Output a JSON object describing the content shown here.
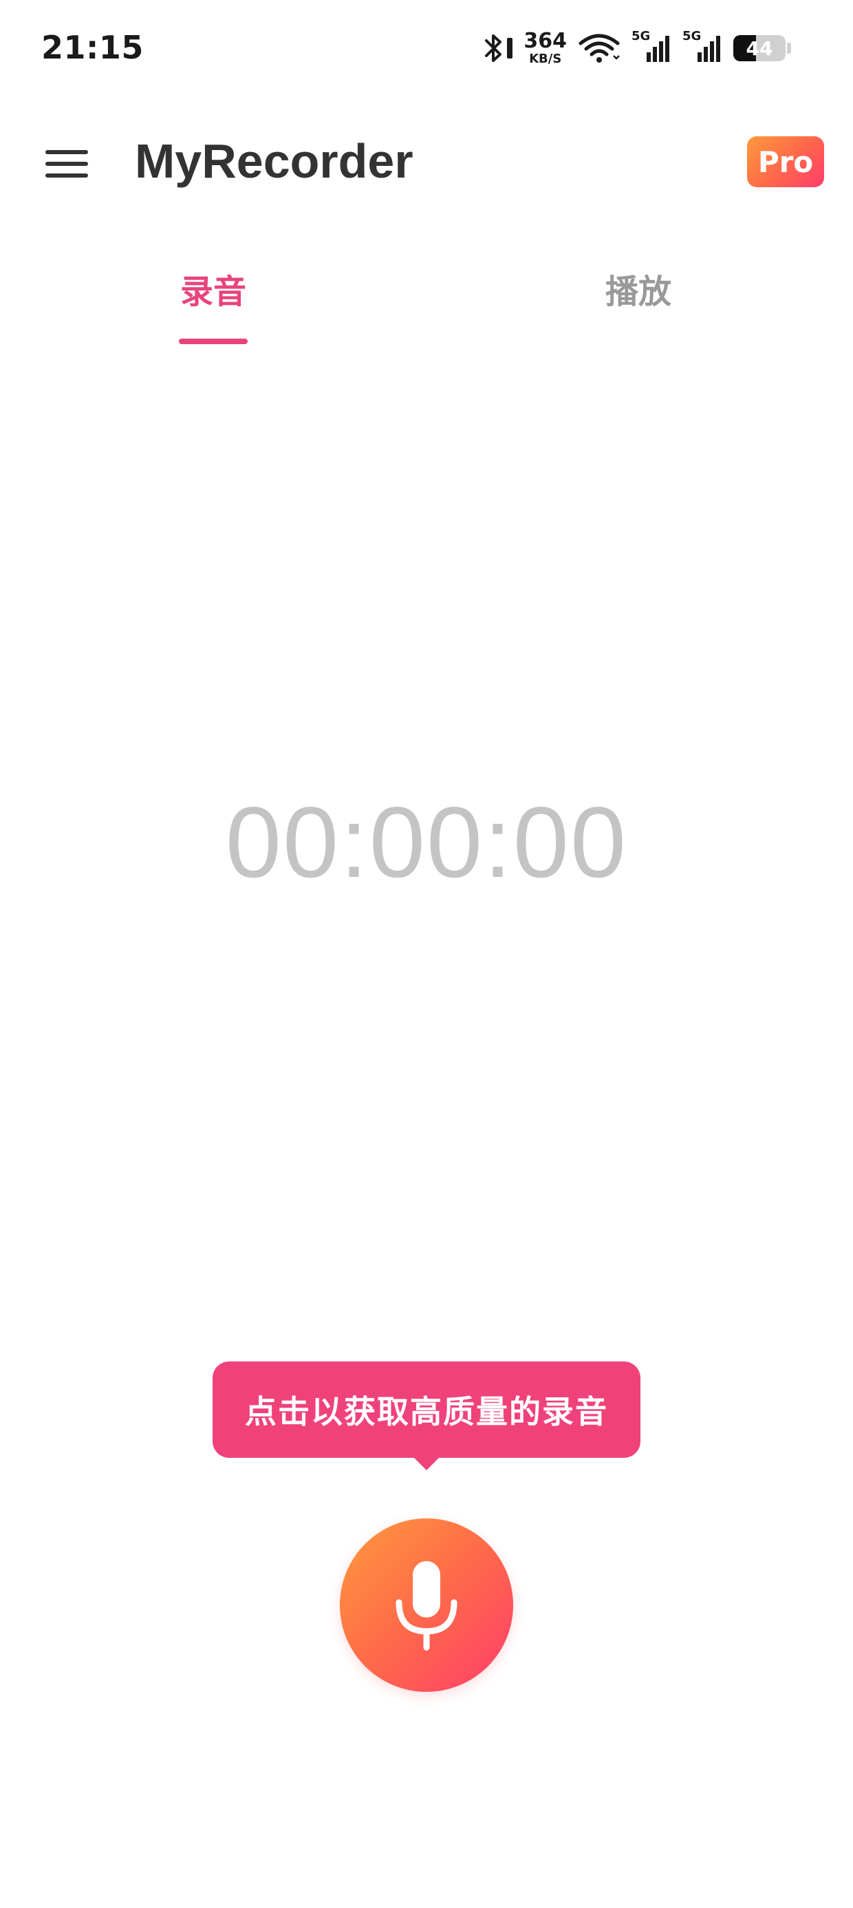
{
  "status_bar": {
    "time": "21:15",
    "net_speed_value": "364",
    "net_speed_unit": "KB/S",
    "signal_1_label": "5G",
    "signal_2_label": "5G",
    "battery_level": "44",
    "battery_fraction": 0.44
  },
  "app_bar": {
    "title": "MyRecorder",
    "pro_label": "Pro"
  },
  "tabs": [
    {
      "label": "录音",
      "active": true
    },
    {
      "label": "播放",
      "active": false
    }
  ],
  "recorder": {
    "timer": "00:00:00",
    "tooltip": "点击以获取高质量的录音"
  },
  "colors": {
    "accent": "#e8447a",
    "tooltip_bg": "#f0427a",
    "gradient_start": "#ff9a3c",
    "gradient_end": "#ff3d6b",
    "timer_text": "#c4c4c4",
    "inactive_tab": "#999999"
  },
  "icons": {
    "menu": "hamburger-menu-icon",
    "record": "microphone-icon",
    "bluetooth": "bluetooth-icon",
    "wifi": "wifi-icon",
    "battery": "battery-icon"
  }
}
